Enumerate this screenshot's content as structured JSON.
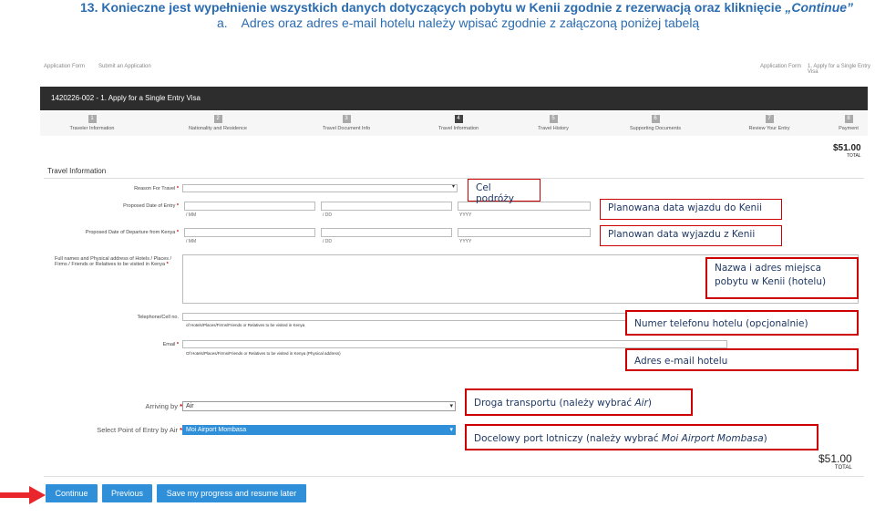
{
  "instruction": {
    "step_number": "13.",
    "text_main": "Konieczne jest wypełnienie wszystkich danych dotyczących pobytu w Kenii zgodnie z rezerwacją oraz kliknięcie",
    "text_link": "„Continue”",
    "sub_marker": "a.",
    "sub_text": "Adres oraz adres e-mail hotelu należy wpisać zgodnie z załączoną poniżej tabelą"
  },
  "app": {
    "crumb_left": "Application Form",
    "crumb_left2": "Submit an Application",
    "crumb_right": "Application Form",
    "crumb_right2": "1. Apply for a Single Entry Visa",
    "title": "1420226-002 - 1. Apply for a Single Entry Visa"
  },
  "steps": [
    {
      "num": "1",
      "label": "Traveler Information"
    },
    {
      "num": "2",
      "label": "Nationality and Residence"
    },
    {
      "num": "3",
      "label": "Travel Document Info"
    },
    {
      "num": "4",
      "label": "Travel Information"
    },
    {
      "num": "5",
      "label": "Travel History"
    },
    {
      "num": "6",
      "label": "Supporting Documents"
    },
    {
      "num": "7",
      "label": "Review Your Entry"
    },
    {
      "num": "8",
      "label": "Payment"
    }
  ],
  "price": {
    "amount": "$51.00",
    "total_label": "TOTAL"
  },
  "form": {
    "section_title": "Travel Information",
    "reason_label": "Reason For Travel",
    "entry_date_label": "Proposed Date of Entry",
    "departure_date_label": "Proposed Date of Departure from Kenya",
    "date_mm": "/ MM",
    "date_dd": "/ DD",
    "date_yyyy": "YYYY",
    "address_label": "Full names and Physical address of Hotels / Places / Firms / Friends or Relatives to be visited in Kenya",
    "phone_label": "Telephone/Cell no.",
    "phone_hint": "of Hotels/Places/Firms/Friends or Relatives to be visited in Kenya",
    "email_label": "Email",
    "email_hint": "Of Hotels/Places/Firms/Friends or Relatives to be visited in Kenya   (Physical address)",
    "required_mark": "*"
  },
  "callouts": {
    "cel": "Cel podróży",
    "arrival": "Planowana data wjazdu do Kenii",
    "departure": "Planowan data wyjazdu z Kenii",
    "address_line1": "Nazwa i adres miejsca",
    "address_line2": "pobytu w Kenii (hotelu)",
    "phone": "Numer telefonu hotelu (opcjonalnie)",
    "email": "Adres e-mail hotelu",
    "transport_prefix": "Droga transportu (należy wybrać ",
    "transport_em": "Air",
    "transport_suffix": ")",
    "port_prefix": "Docelowy port lotniczy (należy wybrać ",
    "port_em": "Moi Airport Mombasa",
    "port_suffix": ")"
  },
  "form2": {
    "arriving_label": "Arriving by",
    "arriving_value": "Air",
    "entry_point_label": "Select Point of Entry by Air",
    "entry_point_value": "Moi Airport Mombasa"
  },
  "buttons": {
    "continue": "Continue",
    "previous": "Previous",
    "save": "Save my progress and resume later"
  },
  "colors": {
    "accent": "#2f8fd8",
    "callout_border": "#cc0000",
    "heading": "#2b6cb0"
  }
}
